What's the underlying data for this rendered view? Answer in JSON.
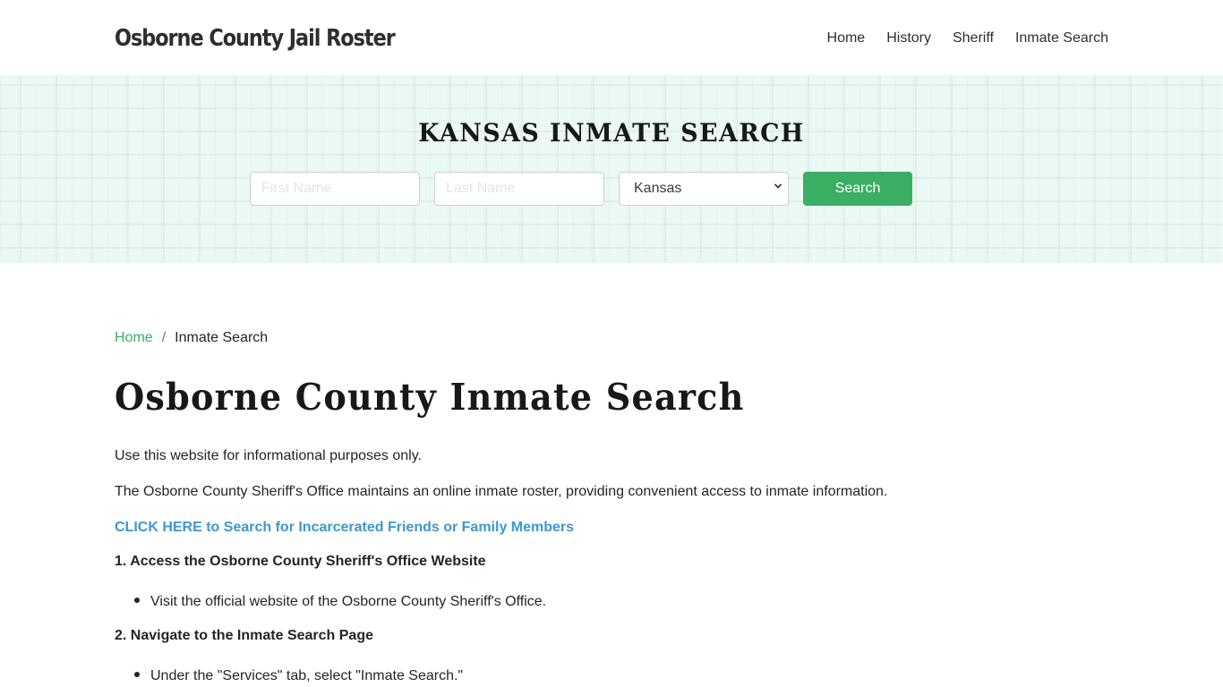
{
  "header": {
    "brand": "Osborne County Jail Roster",
    "nav": [
      {
        "label": "Home"
      },
      {
        "label": "History"
      },
      {
        "label": "Sheriff"
      },
      {
        "label": "Inmate Search"
      }
    ]
  },
  "hero": {
    "title": "KANSAS INMATE SEARCH",
    "first_name": {
      "value": "",
      "placeholder": "First Name"
    },
    "last_name": {
      "value": "",
      "placeholder": "Last Name"
    },
    "state_select": {
      "selected": "Kansas"
    },
    "search_button": "Search",
    "colors": {
      "background": "#ecf8f3",
      "button": "#3aae63"
    }
  },
  "breadcrumb": {
    "home": "Home",
    "separator": "/",
    "current": "Inmate Search"
  },
  "content": {
    "title": "Osborne County Inmate Search",
    "intro": "Use this website for informational purposes only.",
    "description": "The Osborne County Sheriff's Office maintains an online inmate roster, providing convenient access to inmate information.",
    "cta_link": "CLICK HERE to Search for Incarcerated Friends or Family Members",
    "steps": [
      {
        "heading": "1. Access the Osborne County Sheriff's Office Website",
        "bullet": "Visit the official website of the Osborne County Sheriff's Office."
      },
      {
        "heading": "2. Navigate to the Inmate Search Page",
        "bullet": "Under the \"Services\" tab, select \"Inmate Search.\""
      }
    ],
    "colors": {
      "link": "#3e97cf",
      "breadcrumb_link": "#3aae63"
    }
  }
}
